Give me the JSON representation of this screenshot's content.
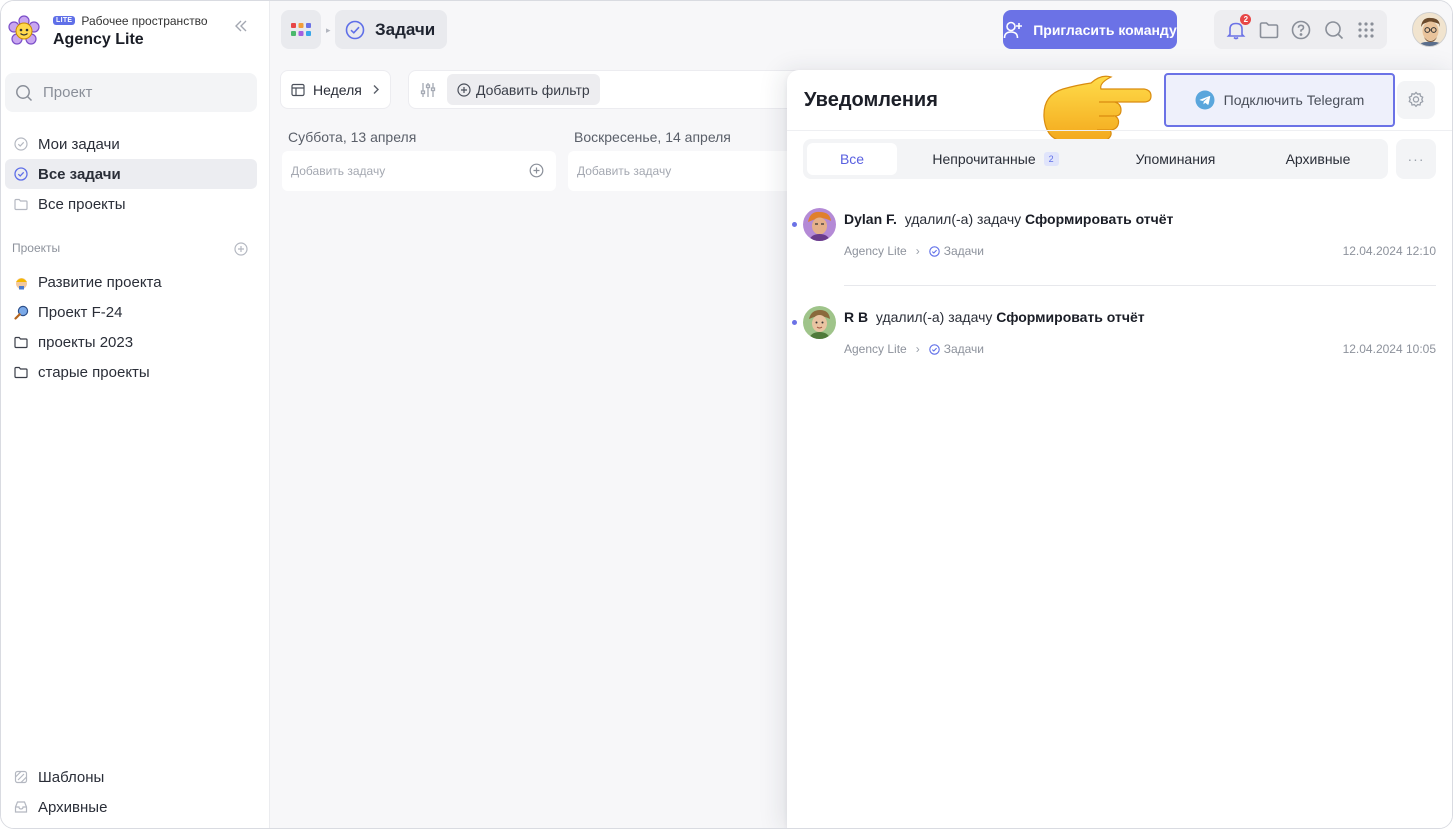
{
  "workspace": {
    "badge": "LITE",
    "subtitle": "Рабочее пространство",
    "name": "Agency Lite"
  },
  "sidebar": {
    "search_placeholder": "Проект",
    "nav": [
      {
        "label": "Мои задачи"
      },
      {
        "label": "Все задачи"
      },
      {
        "label": "Все проекты"
      }
    ],
    "projects_label": "Проекты",
    "projects": [
      {
        "label": "Развитие проекта"
      },
      {
        "label": "Проект F-24"
      },
      {
        "label": "проекты 2023"
      },
      {
        "label": "старые проекты"
      }
    ],
    "bottom": [
      {
        "label": "Шаблоны"
      },
      {
        "label": "Архивные"
      }
    ]
  },
  "topbar": {
    "breadcrumb": "Задачи",
    "invite_label": "Пригласить команду",
    "notifications_count": "2"
  },
  "main": {
    "view_label": "Неделя",
    "add_filter_label": "Добавить фильтр",
    "days": [
      {
        "title": "Суббота, 13 апреля",
        "placeholder": "Добавить задачу"
      },
      {
        "title": "Воскресенье, 14 апреля",
        "placeholder": "Добавить задачу"
      }
    ]
  },
  "notifications": {
    "title": "Уведомления",
    "telegram_label": "Подключить Telegram",
    "tabs": [
      {
        "label": "Все"
      },
      {
        "label": "Непрочитанные",
        "count": "2"
      },
      {
        "label": "Упоминания"
      },
      {
        "label": "Архивные"
      }
    ],
    "more_label": "···",
    "items": [
      {
        "user": "Dylan F.",
        "action": "удалил(-а) задачу",
        "task": "Сформировать отчёт",
        "workspace": "Agency Lite",
        "section": "Задачи",
        "time": "12.04.2024 12:10"
      },
      {
        "user": "R B",
        "action": "удалил(-а) задачу",
        "task": "Сформировать отчёт",
        "workspace": "Agency Lite",
        "section": "Задачи",
        "time": "12.04.2024 10:05"
      }
    ]
  },
  "colors": {
    "accent": "#6b72e6",
    "badge_red": "#e74646",
    "unread_dot": "#6b72e6"
  }
}
